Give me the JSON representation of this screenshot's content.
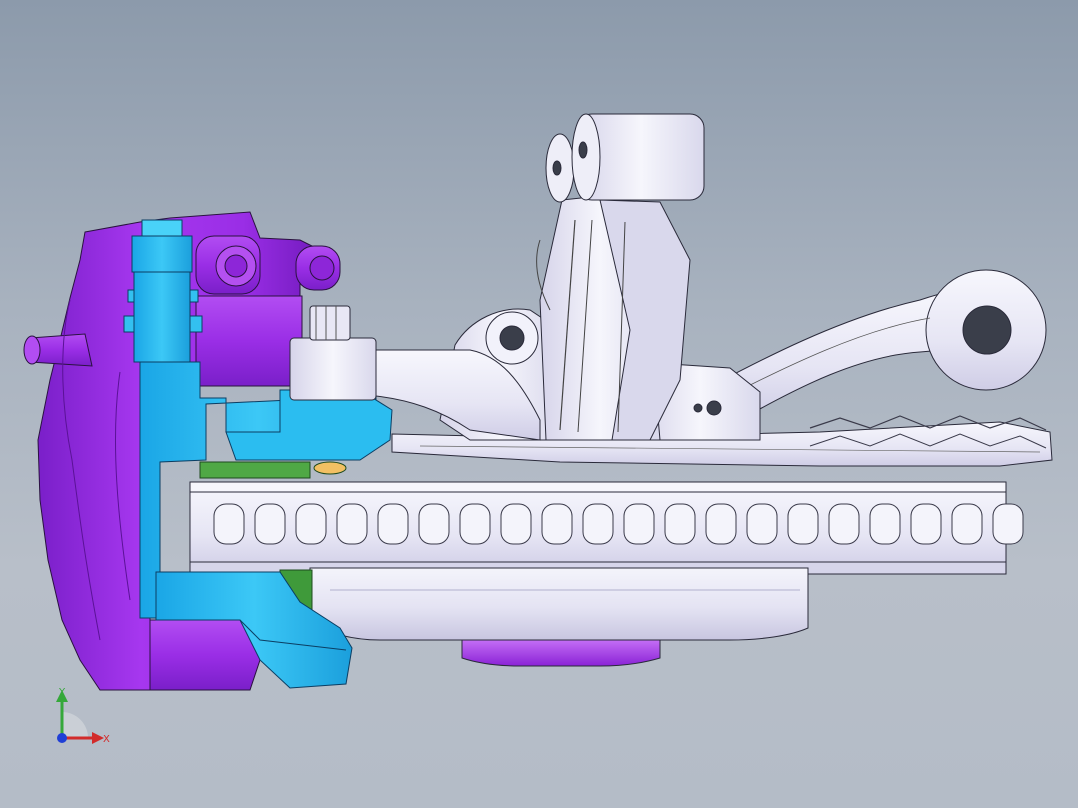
{
  "viewport": {
    "background_top": "#8c9aab",
    "background_bottom": "#b4bcc7"
  },
  "model": {
    "parts": [
      {
        "name": "brake-caliper",
        "color": "#9a2ee6"
      },
      {
        "name": "caliper-bracket",
        "color": "#22b4ee"
      },
      {
        "name": "brake-disc",
        "color": "#ecebf8"
      },
      {
        "name": "wheel-hub",
        "color": "#e8e7f6"
      },
      {
        "name": "hub-bearing",
        "color": "#a032e8"
      },
      {
        "name": "steering-knuckle",
        "color": "#eeedf9"
      },
      {
        "name": "control-arm",
        "color": "#efeefa"
      },
      {
        "name": "brake-pad",
        "color": "#3f9a3a"
      },
      {
        "name": "tie-rod-arm",
        "color": "#eeedf9"
      }
    ]
  },
  "triad": {
    "x_label": "X",
    "y_label": "Y",
    "x_color": "#d22b2b",
    "y_color": "#35a83a",
    "z_color": "#1f3fd6"
  }
}
